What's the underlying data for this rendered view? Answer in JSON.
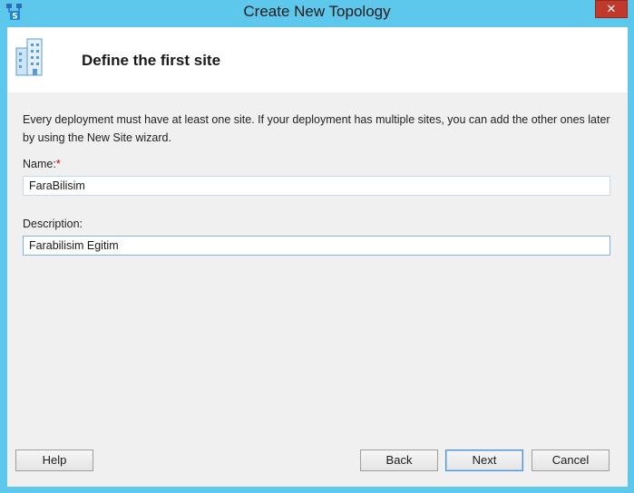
{
  "window": {
    "title": "Create New Topology",
    "close_glyph": "✕",
    "app_icon": "topology-builder-icon",
    "accent": "#5ec8ec",
    "close_color": "#c0392b"
  },
  "header": {
    "title": "Define the first site",
    "icon": "building-icon"
  },
  "intro_text": "Every deployment must have at least one site. If your deployment has multiple sites, you can add the other ones later by using the New Site wizard.",
  "form": {
    "name_label": "Name:",
    "required_mark": "*",
    "name_value": "FaraBilisim",
    "description_label": "Description:",
    "description_value": "Farabilisim Egitim"
  },
  "buttons": {
    "help": "Help",
    "back": "Back",
    "next": "Next",
    "cancel": "Cancel"
  }
}
